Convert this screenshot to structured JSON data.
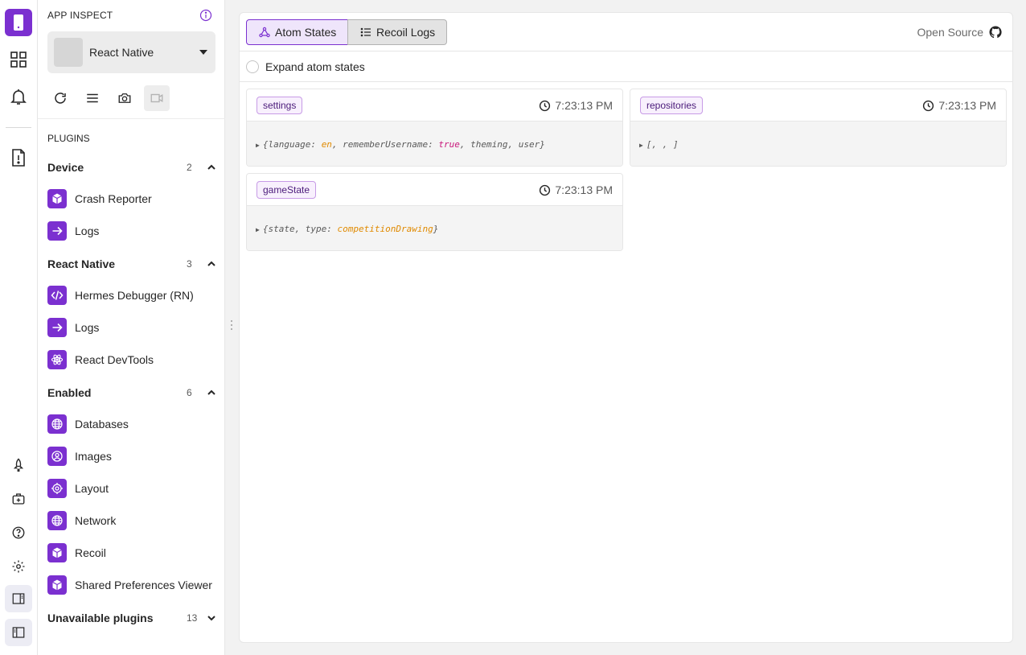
{
  "sidebar": {
    "title": "APP INSPECT",
    "device": "React Native",
    "plugins_heading": "PLUGINS",
    "groups": [
      {
        "title": "Device",
        "count": "2",
        "items": [
          {
            "label": "Crash Reporter",
            "icon": "package-icon"
          },
          {
            "label": "Logs",
            "icon": "arrow-right-icon"
          }
        ]
      },
      {
        "title": "React Native",
        "count": "3",
        "items": [
          {
            "label": "Hermes Debugger (RN)",
            "icon": "code-icon"
          },
          {
            "label": "Logs",
            "icon": "arrow-right-icon"
          },
          {
            "label": "React DevTools",
            "icon": "atom-icon"
          }
        ]
      },
      {
        "title": "Enabled",
        "count": "6",
        "items": [
          {
            "label": "Databases",
            "icon": "globe-icon"
          },
          {
            "label": "Images",
            "icon": "user-circle-icon"
          },
          {
            "label": "Layout",
            "icon": "target-icon"
          },
          {
            "label": "Network",
            "icon": "globe-icon"
          },
          {
            "label": "Recoil",
            "icon": "package-icon"
          },
          {
            "label": "Shared Preferences Viewer",
            "icon": "package-icon"
          }
        ]
      },
      {
        "title": "Unavailable plugins",
        "count": "13",
        "items": []
      }
    ]
  },
  "toolbar": {
    "tab_atom": "Atom States",
    "tab_logs": "Recoil Logs",
    "open_source": "Open Source",
    "expand_label": "Expand atom states"
  },
  "atoms": [
    {
      "name": "settings",
      "time": "7:23:13 PM",
      "value": [
        [
          "{language: ",
          "p"
        ],
        [
          "en",
          "s"
        ],
        [
          ", rememberUsername: ",
          "p"
        ],
        [
          "true",
          "b"
        ],
        [
          ", theming, user}",
          "p"
        ]
      ]
    },
    {
      "name": "repositories",
      "time": "7:23:13 PM",
      "value": [
        [
          "[, , ]",
          "p"
        ]
      ]
    },
    {
      "name": "gameState",
      "time": "7:23:13 PM",
      "value": [
        [
          "{state, type: ",
          "p"
        ],
        [
          "competitionDrawing",
          "s"
        ],
        [
          "}",
          "p"
        ]
      ]
    }
  ],
  "colors": {
    "accent": "#7b30d0",
    "string": "#e08a00",
    "boolean": "#c8177a"
  }
}
